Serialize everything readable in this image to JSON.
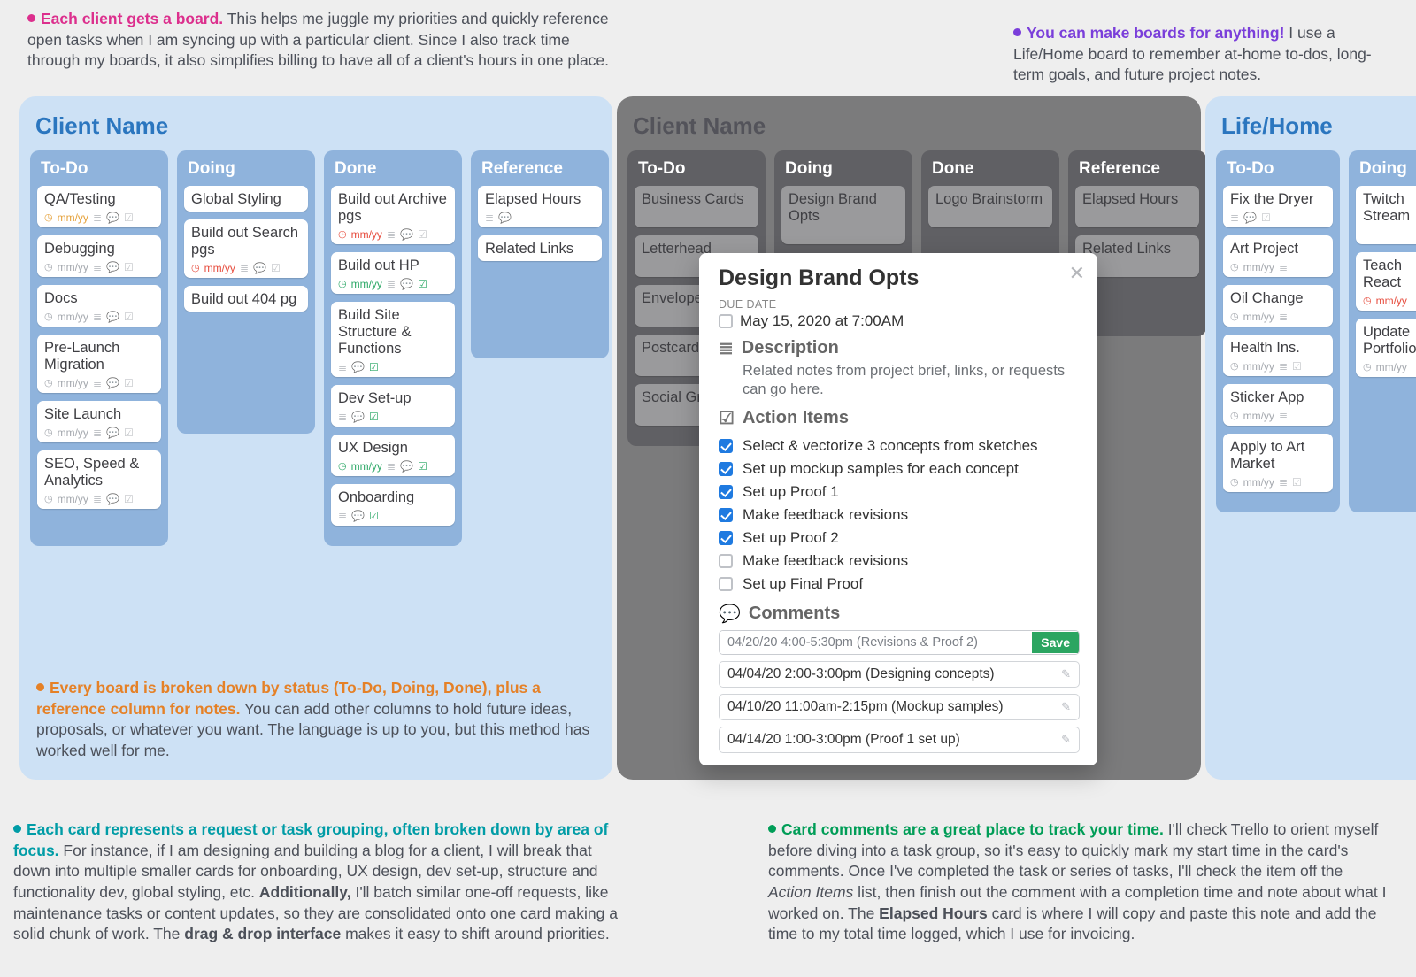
{
  "annotations": {
    "top_left_lead": "Each client gets a board.",
    "top_left_body": " This helps me juggle my priorities and quickly reference open tasks when I am syncing up with a particular client. Since I also track time through my boards, it also simplifies billing to have all of a client's hours in one place.",
    "top_right_lead": "You can make boards for anything!",
    "top_right_body": " I use a Life/Home board to remember at-home to-dos, long-term goals, and future project notes.",
    "orange_lead": "Every board is broken down by status (To-Do, Doing, Done), plus a reference column for notes.",
    "orange_body": " You can add other columns to hold future ideas, proposals, or whatever you want. The language is up to you, but this method has worked well for me.",
    "teal_lead": "Each card represents a request or task grouping, often broken down by area of focus.",
    "teal_body1": " For instance, if I am designing and building a blog for a client, I will break that down into multiple smaller cards for onboarding, UX design, dev set-up, structure and functionality dev, global styling, etc. ",
    "teal_add": "Additionally,",
    "teal_body2": " I'll batch similar one-off requests, like maintenance tasks or content updates, so they are consolidated onto one card making a solid chunk of work. The ",
    "teal_dd": "drag & drop interface",
    "teal_body3": " makes it easy to shift around priorities.",
    "green_lead": "Card comments are a great place to track your time.",
    "green_body1": " I'll check Trello to orient myself before diving into a task group, so it's easy to quickly mark my start time in the card's comments. Once I've completed the task or series of tasks, I'll check the item off the ",
    "green_ai": "Action Items",
    "green_body2": " list, then finish out the comment with a completion time and note about what I worked on. The ",
    "green_eh": "Elapsed Hours",
    "green_body3": " card is where I will copy and paste this note and add the time to my total time logged, which I use for invoicing."
  },
  "meta_mmyy": "mm/yy",
  "boards": [
    {
      "title": "Client Name",
      "lists": [
        {
          "title": "To-Do",
          "cards": [
            {
              "label": "QA/Testing",
              "meta": "orange"
            },
            {
              "label": "Debugging",
              "meta": "grey"
            },
            {
              "label": "Docs",
              "meta": "grey"
            },
            {
              "label": "Pre-Launch Migration",
              "meta": "grey"
            },
            {
              "label": "Site Launch",
              "meta": "grey"
            },
            {
              "label": "SEO, Speed & Analytics",
              "meta": "grey"
            }
          ]
        },
        {
          "title": "Doing",
          "cards": [
            {
              "label": "Global Styling",
              "meta": "none"
            },
            {
              "label": "Build out Search pgs",
              "meta": "red"
            },
            {
              "label": "Build out 404 pg",
              "meta": "none"
            }
          ]
        },
        {
          "title": "Done",
          "cards": [
            {
              "label": "Build out Archive pgs",
              "meta": "red"
            },
            {
              "label": "Build out HP",
              "meta": "green"
            },
            {
              "label": "Build Site Structure & Functions",
              "meta": "greencheck"
            },
            {
              "label": "Dev Set-up",
              "meta": "greencheck"
            },
            {
              "label": "UX Design",
              "meta": "green"
            },
            {
              "label": "Onboarding",
              "meta": "greencheck"
            }
          ]
        },
        {
          "title": "Reference",
          "cards": [
            {
              "label": "Elapsed Hours",
              "meta": "plain"
            },
            {
              "label": "Related Links",
              "meta": "none"
            }
          ]
        }
      ]
    },
    {
      "title": "Client Name",
      "lists": [
        {
          "title": "To-Do",
          "cards": [
            {
              "label": "Business Cards"
            },
            {
              "label": "Letterhead"
            },
            {
              "label": "Envelopes"
            },
            {
              "label": "Postcards"
            },
            {
              "label": "Social Graphics"
            }
          ]
        },
        {
          "title": "Doing",
          "cards": [
            {
              "label": "Design Brand Opts"
            }
          ]
        },
        {
          "title": "Done",
          "cards": [
            {
              "label": "Logo Brainstorm"
            }
          ]
        },
        {
          "title": "Reference",
          "cards": [
            {
              "label": "Elapsed Hours"
            },
            {
              "label": "Related Links"
            }
          ]
        }
      ]
    },
    {
      "title": "Life/Home",
      "lists": [
        {
          "title": "To-Do",
          "cards": [
            {
              "label": "Fix the Dryer"
            },
            {
              "label": "Art Project"
            },
            {
              "label": "Oil Change"
            },
            {
              "label": "Health Ins."
            },
            {
              "label": "Sticker App"
            },
            {
              "label": "Apply to Art Market"
            }
          ]
        },
        {
          "title": "Doing",
          "cards": [
            {
              "label": "Twitch Stream"
            },
            {
              "label": "Teach React"
            },
            {
              "label": "Update Portfolio"
            }
          ]
        }
      ]
    }
  ],
  "modal": {
    "title": "Design Brand Opts",
    "due_label": "DUE DATE",
    "due_value": "May 15, 2020 at 7:00AM",
    "desc_h": "Description",
    "desc_body": "Related notes from project brief, links, or requests can go here.",
    "ai_h": "Action Items",
    "ai": [
      {
        "done": true,
        "text": "Select & vectorize 3 concepts from sketches"
      },
      {
        "done": true,
        "text": "Set up mockup samples for each concept"
      },
      {
        "done": true,
        "text": "Set up Proof 1"
      },
      {
        "done": true,
        "text": "Make feedback revisions"
      },
      {
        "done": true,
        "text": "Set up Proof 2"
      },
      {
        "done": false,
        "text": "Make feedback revisions"
      },
      {
        "done": false,
        "text": "Set up Final Proof"
      }
    ],
    "comments_h": "Comments",
    "comment_input": "04/20/20 4:00-5:30pm (Revisions & Proof 2)",
    "save": "Save",
    "comments": [
      "04/04/20 2:00-3:00pm (Designing concepts)",
      "04/10/20 11:00am-2:15pm (Mockup samples)",
      "04/14/20 1:00-3:00pm (Proof 1 set up)"
    ]
  }
}
